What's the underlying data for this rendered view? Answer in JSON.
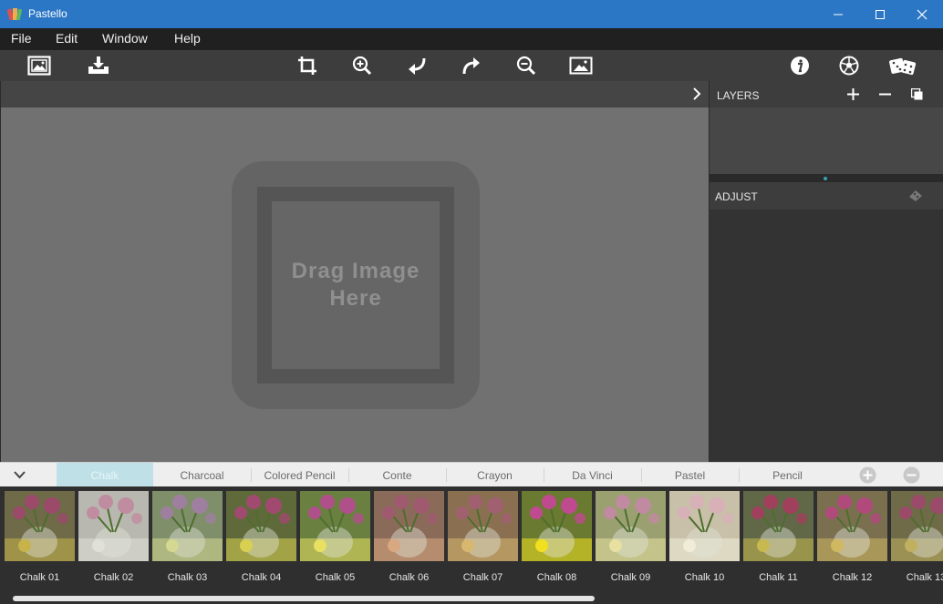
{
  "window": {
    "title": "Pastello"
  },
  "menu": {
    "items": [
      "File",
      "Edit",
      "Window",
      "Help"
    ]
  },
  "toolbar": {
    "left": [
      "open-image-icon",
      "save-download-icon"
    ],
    "center": [
      "crop-icon",
      "zoom-in-icon",
      "undo-icon",
      "redo-icon",
      "zoom-out-icon",
      "fit-image-icon"
    ],
    "right": [
      "info-icon",
      "soccer-ball-icon",
      "dice-icon"
    ]
  },
  "canvas": {
    "drop_text": "Drag Image\nHere"
  },
  "layers": {
    "title": "LAYERS"
  },
  "adjust": {
    "title": "ADJUST"
  },
  "tabs": {
    "items": [
      "Chalk",
      "Charcoal",
      "Colored Pencil",
      "Conte",
      "Crayon",
      "Da Vinci",
      "Pastel",
      "Pencil"
    ],
    "active": "Chalk"
  },
  "presets": {
    "items": [
      "Chalk 01",
      "Chalk 02",
      "Chalk 03",
      "Chalk 04",
      "Chalk 05",
      "Chalk 06",
      "Chalk 07",
      "Chalk 08",
      "Chalk 09",
      "Chalk 10",
      "Chalk 11",
      "Chalk 12",
      "Chalk 13"
    ],
    "scroll_fraction": 0.62
  },
  "colors": {
    "titlebar": "#2b77c5",
    "active_tab": "#bfe0e7",
    "accent": "#3aa0b8"
  }
}
